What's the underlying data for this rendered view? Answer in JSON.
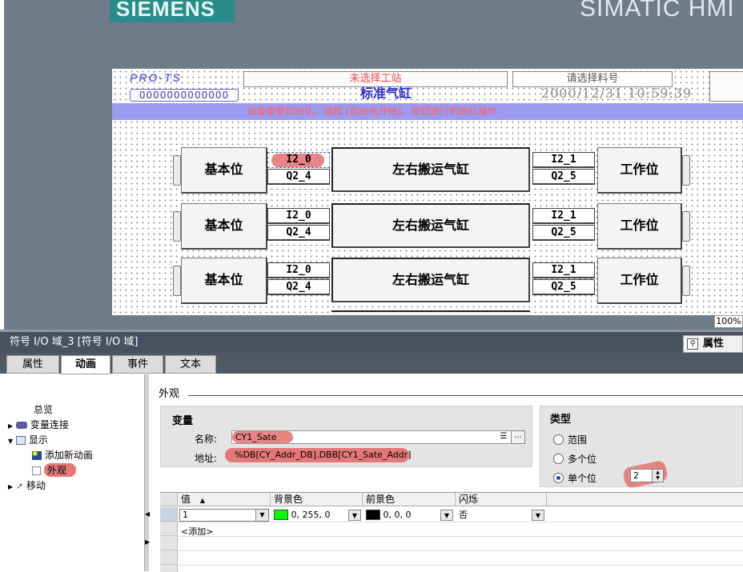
{
  "device": {
    "brand": "SIEMENS",
    "model": "SIMATIC HMI"
  },
  "hmi": {
    "logo_text": "PRO-TS",
    "station": "未选择工站",
    "material_prompt": "请选择料号",
    "serial": "0000000000000",
    "title": "标准气缸",
    "datetime": "2000/12/31 10:59:39",
    "banner": "设备需要初始化，请按 [初始化开始]，按钮进行初始化操作",
    "rows": [
      {
        "left": "基本位",
        "in_left": "I2_0",
        "out_left": "Q2_4",
        "name": "左右搬运气缸",
        "in_right": "I2_1",
        "out_right": "Q2_5",
        "right": "工作位"
      },
      {
        "left": "基本位",
        "in_left": "I2_0",
        "out_left": "Q2_4",
        "name": "左右搬运气缸",
        "in_right": "I2_1",
        "out_right": "Q2_5",
        "right": "工作位"
      },
      {
        "left": "基本位",
        "in_left": "I2_0",
        "out_left": "Q2_4",
        "name": "左右搬运气缸",
        "in_right": "I2_1",
        "out_right": "Q2_5",
        "right": "工作位"
      }
    ],
    "zoom": "100%"
  },
  "properties": {
    "title": "符号 I/O 域_3 [符号 I/O 域]",
    "panel_button": "属性",
    "tabs": [
      "属性",
      "动画",
      "事件",
      "文本"
    ],
    "active_tab": "动画",
    "nav": {
      "overview": "总览",
      "var_conn": "变量连接",
      "display": "显示",
      "add_anim": "添加新动画",
      "appearance": "外观",
      "move": "移动"
    },
    "section": "外观",
    "variable": {
      "header": "变量",
      "name_label": "名称:",
      "name_value": "CY1_Sate",
      "addr_label": "地址:",
      "addr_value": "%DB[CY_Addr_DB].DBB[CY1_Sate_Addr]"
    },
    "type": {
      "header": "类型",
      "opt_range": "范围",
      "opt_multi": "多个位",
      "opt_single": "单个位",
      "selected": "单个位",
      "bit": "2"
    },
    "grid": {
      "headers": [
        "值",
        "背景色",
        "前景色",
        "闪烁"
      ],
      "row": {
        "value": "1",
        "bg": "0, 255, 0",
        "fg": "0, 0, 0",
        "flash": "否"
      },
      "add": "<添加>",
      "colors": {
        "bg": "#00ff00",
        "fg": "#000000"
      }
    }
  }
}
